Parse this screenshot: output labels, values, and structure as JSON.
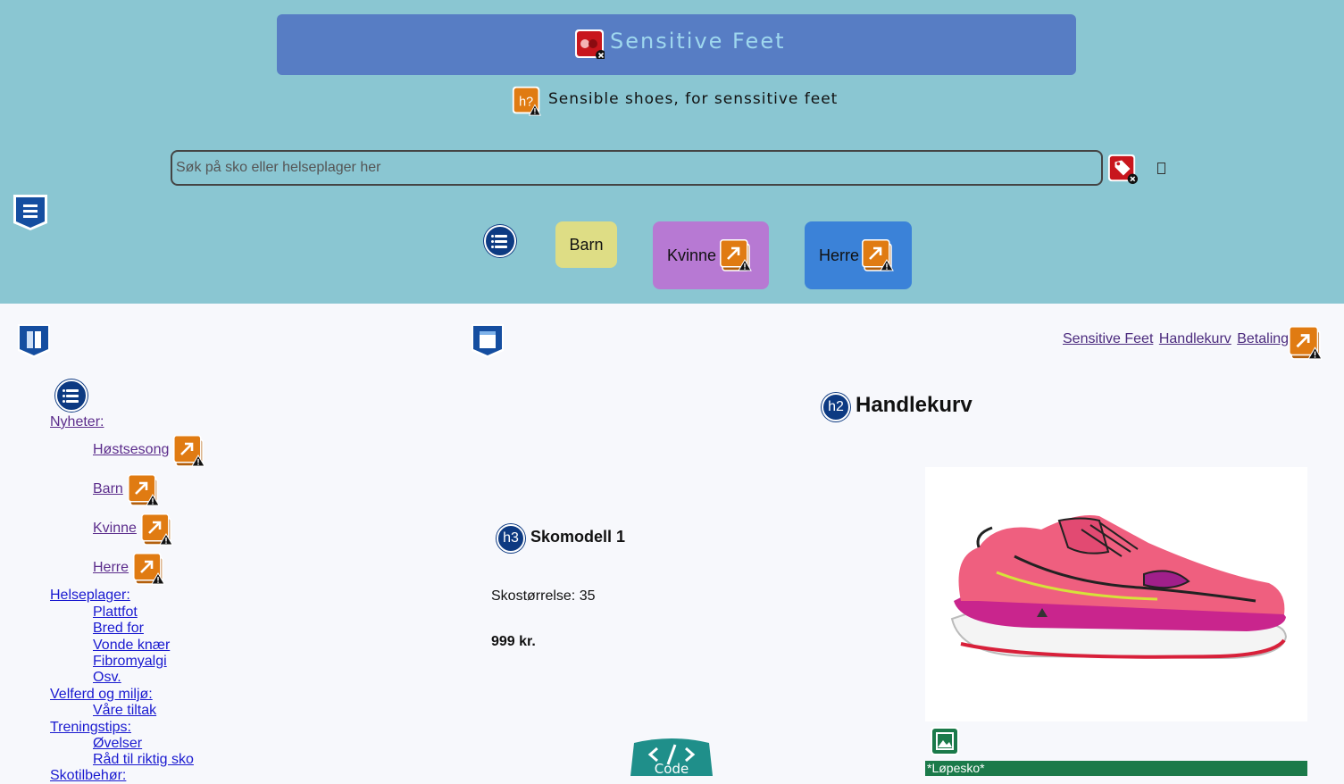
{
  "header": {
    "site_title": "Sensitive Feet",
    "tagline": "Sensible shoes, for senssitive feet",
    "search": {
      "placeholder": "Søk på sko eller helseplager her"
    },
    "nav_buttons": [
      {
        "label": "Barn",
        "color": "#dedd85"
      },
      {
        "label": "Kvinne",
        "color": "#b779d3"
      },
      {
        "label": "Herre",
        "color": "#3b82d8"
      }
    ]
  },
  "breadcrumb": [
    "Sensitive Feet",
    "Handlekurv",
    "Betaling"
  ],
  "sidebar": {
    "sections": [
      {
        "label": "Nyheter:",
        "items": [
          "Høstsesong",
          "Barn",
          "Kvinne",
          "Herre"
        ]
      },
      {
        "label": "Helseplager:",
        "items": [
          "Plattfot",
          "Bred for",
          "Vonde knær",
          "Fibromyalgi",
          "Osv."
        ]
      },
      {
        "label": "Velferd og miljø:",
        "items": [
          "Våre tiltak"
        ]
      },
      {
        "label": "Treningstips:",
        "items": [
          "Øvelser",
          "Råd til riktig sko"
        ]
      },
      {
        "label": "Skotilbehør:",
        "items": []
      }
    ]
  },
  "main": {
    "heading": "Handlekurv",
    "heading_badge": "h2",
    "product": {
      "title": "Skomodell 1",
      "title_badge": "h3",
      "size": "Skostørrelse: 35",
      "price": "999 kr.",
      "caption": "*Løpesko*"
    }
  },
  "tagline_badge": "h?",
  "code_tab": {
    "label": "Code",
    "color": "#1f8f8a"
  },
  "colors": {
    "header_bg": "#8ac6d2",
    "title_bar": "#577dc4",
    "page_bg": "#f7f8fc",
    "accent_orange": "#e07b12",
    "badge_navy": "#0d3a82",
    "caption_green": "#1b7a4a"
  }
}
